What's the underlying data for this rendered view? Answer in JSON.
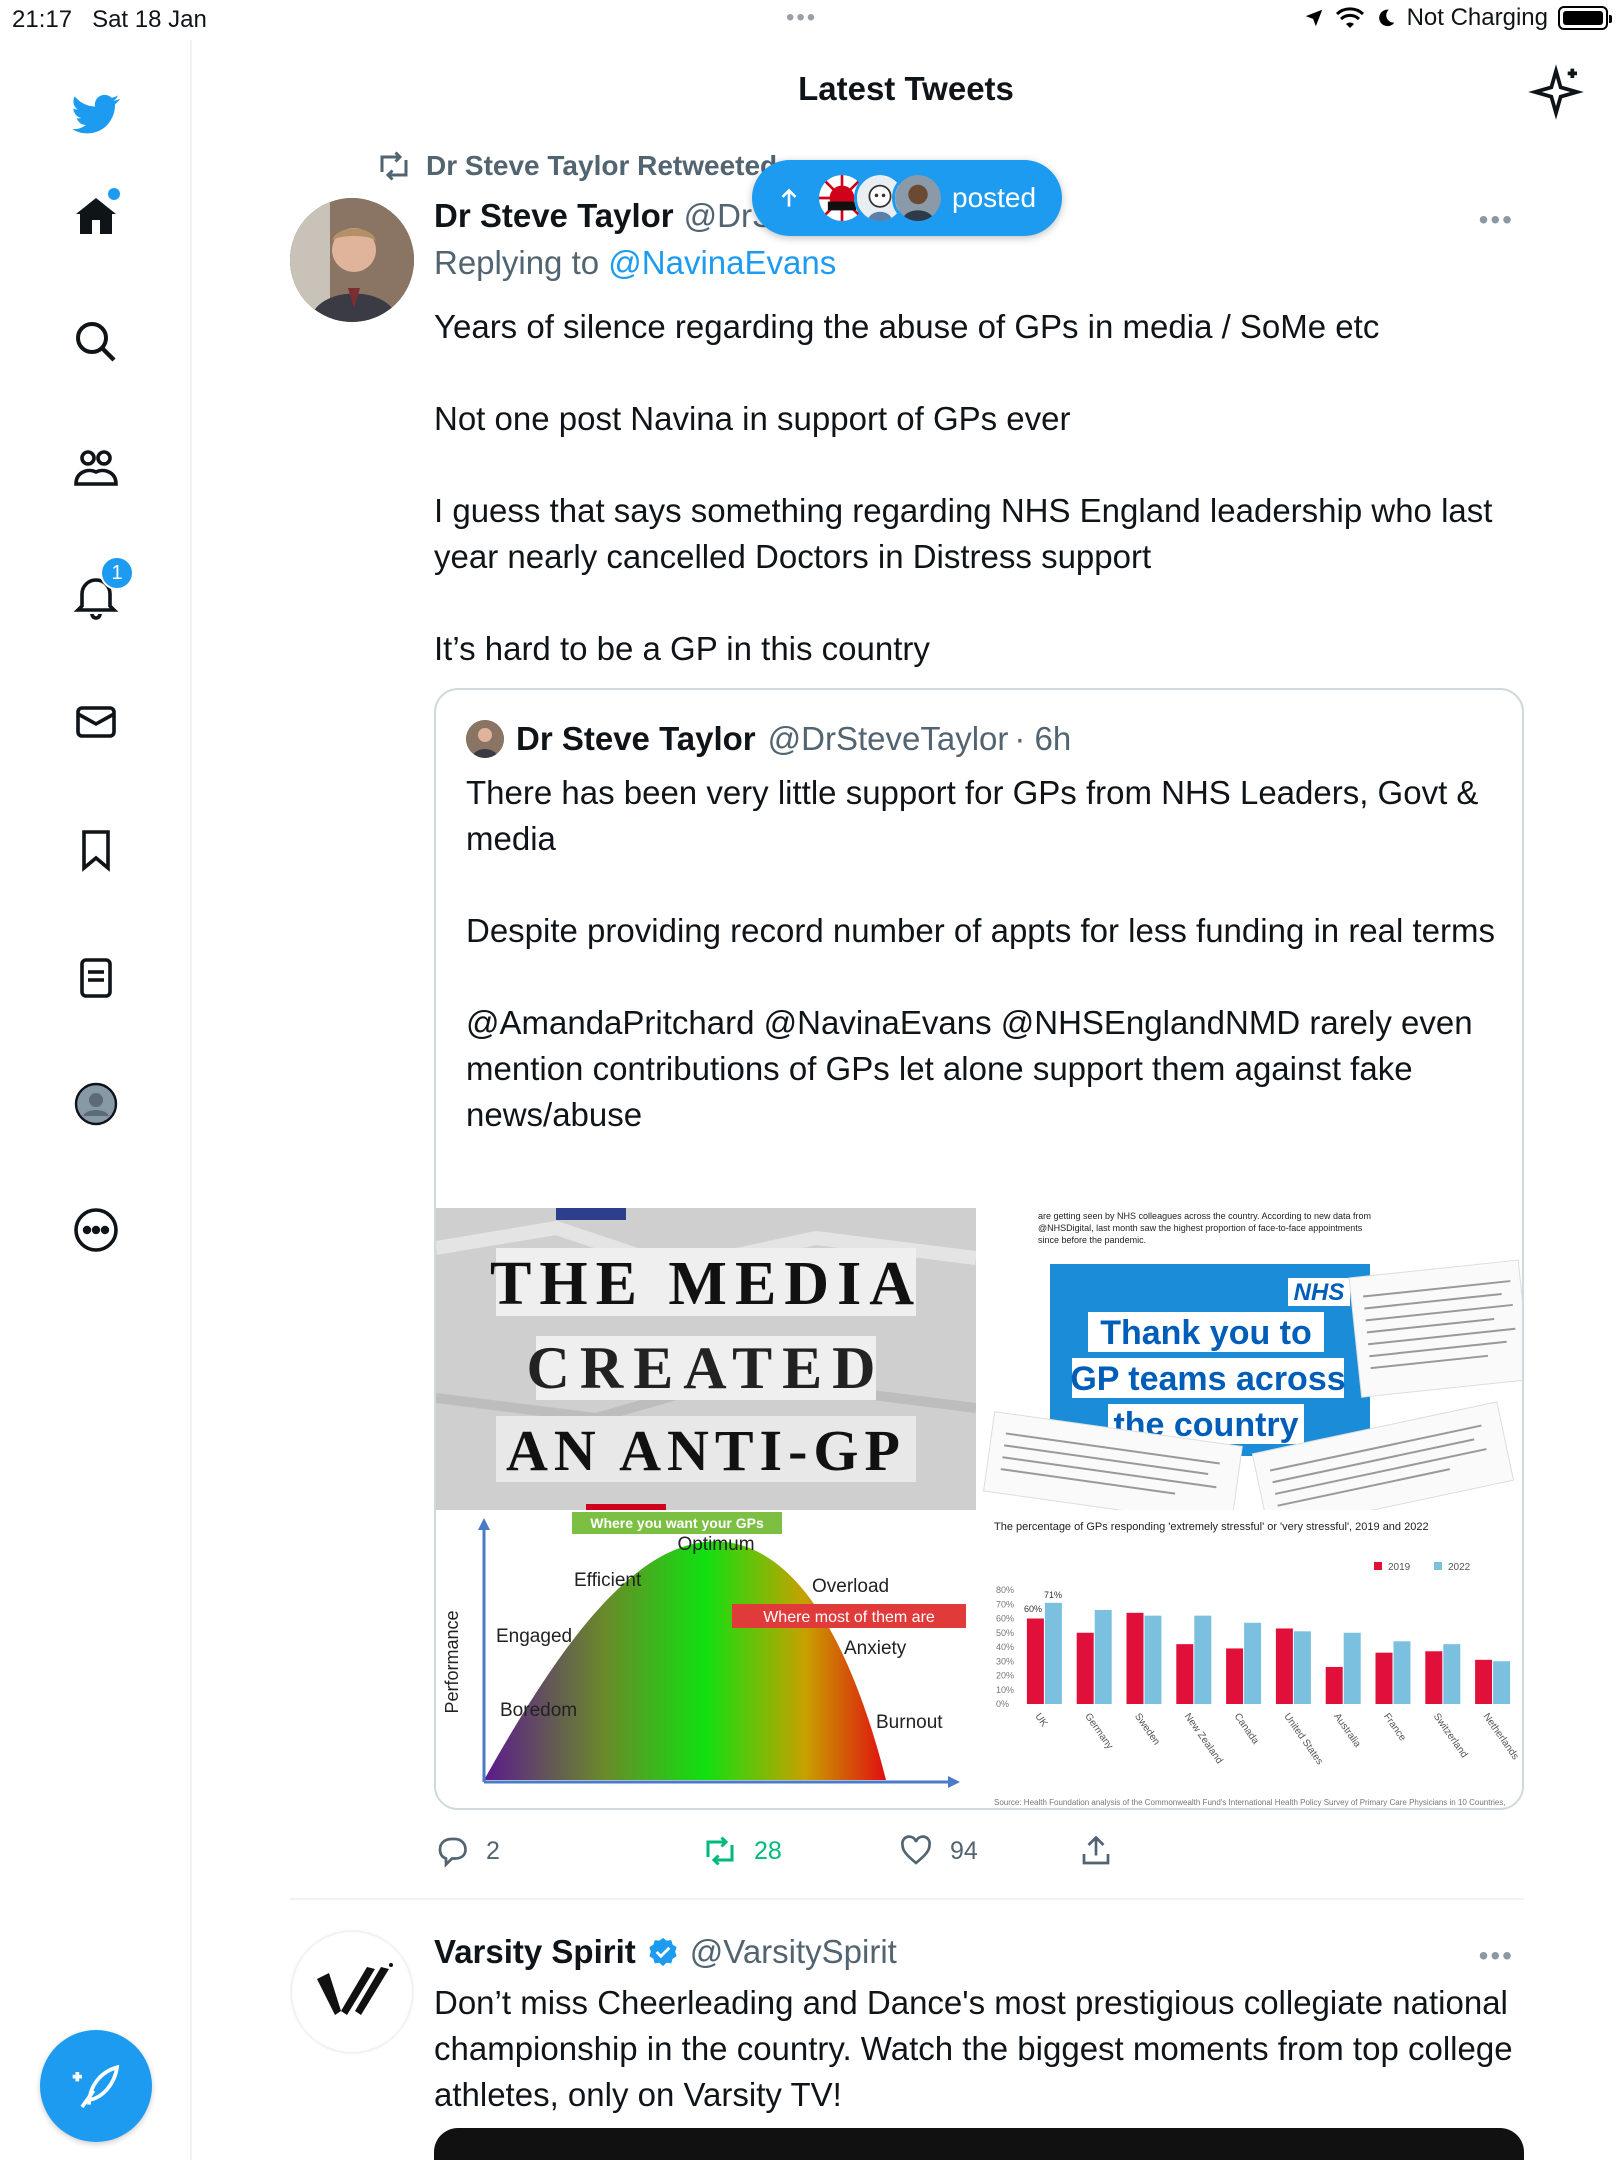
{
  "status_bar": {
    "time": "21:17",
    "date": "Sat 18 Jan",
    "dots": "•••",
    "charging": "Not Charging"
  },
  "header": {
    "title": "Latest Tweets"
  },
  "sidebar": {
    "items": [
      {
        "name": "home",
        "icon": "home-icon"
      },
      {
        "name": "search",
        "icon": "search-icon"
      },
      {
        "name": "communities",
        "icon": "communities-icon"
      },
      {
        "name": "notifications",
        "icon": "bell-icon",
        "badge": "1"
      },
      {
        "name": "messages",
        "icon": "mail-icon"
      },
      {
        "name": "bookmarks",
        "icon": "bookmark-icon"
      },
      {
        "name": "lists",
        "icon": "list-icon"
      },
      {
        "name": "profile",
        "icon": "profile-icon"
      },
      {
        "name": "more",
        "icon": "more-icon"
      }
    ]
  },
  "new_posts_pill": {
    "label": "posted"
  },
  "tweet1": {
    "retweeted_by": "Dr Steve Taylor Retweeted",
    "name": "Dr Steve Taylor",
    "handle": "@DrSteveTaylor",
    "replying_label": "Replying to ",
    "replying_to": "@NavinaEvans",
    "text": [
      "Years of silence regarding the abuse of GPs in media / SoMe etc",
      "Not one post Navina in support of GPs ever",
      "I guess that says something regarding NHS England leadership who last year nearly cancelled Doctors in Distress support",
      "It’s hard to be a GP in this country"
    ],
    "quote": {
      "name": "Dr Steve Taylor",
      "handle": "@DrSteveTaylor",
      "time": "· 6h",
      "text": [
        "There has been very little support for GPs from NHS Leaders, Govt & media",
        "Despite providing record number of appts for less funding in real terms",
        "@AmandaPritchard @NavinaEvans @NHSEnglandNMD rarely even mention contributions of GPs let alone support them against fake news/abuse"
      ],
      "media": {
        "img1": {
          "line1": "THE MEDIA",
          "line2": "CREATED",
          "line3": "AN ANTI-GP"
        },
        "img2": {
          "caption_top": "are getting seen by NHS colleagues across the country. According to new data from @NHSDigital, last month saw the highest proportion of face-to-face appointments since before the pandemic.",
          "nhs": "NHS",
          "headline1": "Thank you to",
          "headline2": "GP teams across",
          "headline3": "the country"
        },
        "img3": {
          "ylabel": "Performance",
          "top_banner": "Where you want your GPs",
          "optimum": "Optimum",
          "efficient": "Efficient",
          "engaged": "Engaged",
          "boredom": "Boredom",
          "overload": "Overload",
          "most": "Where most of them are",
          "anxiety": "Anxiety",
          "burnout": "Burnout"
        },
        "img4": {
          "title": "The percentage of GPs responding 'extremely stressful' or 'very stressful', 2019 and 2022",
          "legend": [
            "2019",
            "2022"
          ],
          "annotations": [
            "71%",
            "60%"
          ],
          "ticks": [
            "80%",
            "70%",
            "60%",
            "50%",
            "40%",
            "30%",
            "20%",
            "10%",
            "0%"
          ],
          "source": "Source: Health Foundation analysis of the Commonwealth Fund's International Health Policy Survey of Primary Care Physicians in 10 Countries, 2019 and 2022"
        }
      }
    },
    "stats": {
      "replies": "2",
      "retweets": "28",
      "likes": "94"
    }
  },
  "tweet2": {
    "name": "Varsity Spirit",
    "handle": "@VarsitySpirit",
    "text": "Don’t miss Cheerleading and Dance's most prestigious collegiate national championship in the country. Watch the biggest moments from top college athletes, only on Varsity TV!"
  },
  "colors": {
    "accent": "#1d9bf0",
    "retweet_green": "#00ba7c",
    "secondary_text": "#536471",
    "border": "#cfd9de"
  },
  "chart_data": {
    "type": "bar",
    "title": "The percentage of GPs responding 'extremely stressful' or 'very stressful', 2019 and 2022",
    "categories": [
      "UK",
      "Germany",
      "Sweden",
      "New Zealand",
      "Canada",
      "United States",
      "Australia",
      "France",
      "Switzerland",
      "Netherlands"
    ],
    "series": [
      {
        "name": "2019",
        "values": [
          60,
          50,
          64,
          42,
          39,
          53,
          26,
          36,
          37,
          31
        ]
      },
      {
        "name": "2022",
        "values": [
          71,
          66,
          62,
          62,
          57,
          51,
          50,
          44,
          42,
          30
        ]
      }
    ],
    "ylim": [
      0,
      80
    ],
    "legend": "top-right",
    "grid": false
  }
}
